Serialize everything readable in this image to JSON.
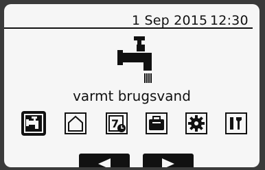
{
  "status": {
    "date": "1 Sep 2015",
    "time": "12:30"
  },
  "main": {
    "mode_label": "varmt brugsvand",
    "hero_icon": "faucet-icon"
  },
  "menu": {
    "items": [
      {
        "icon": "hot-water-icon",
        "selected": true
      },
      {
        "icon": "home-icon",
        "selected": false
      },
      {
        "icon": "schedule-icon",
        "selected": false
      },
      {
        "icon": "holiday-suitcase-icon",
        "selected": false
      },
      {
        "icon": "settings-gear-icon",
        "selected": false
      },
      {
        "icon": "service-tools-icon",
        "selected": false
      }
    ]
  },
  "nav": {
    "prev_icon": "arrow-left-icon",
    "next_icon": "arrow-right-icon"
  },
  "colors": {
    "screen_bg": "#f6f6f6",
    "foreground": "#111111"
  }
}
